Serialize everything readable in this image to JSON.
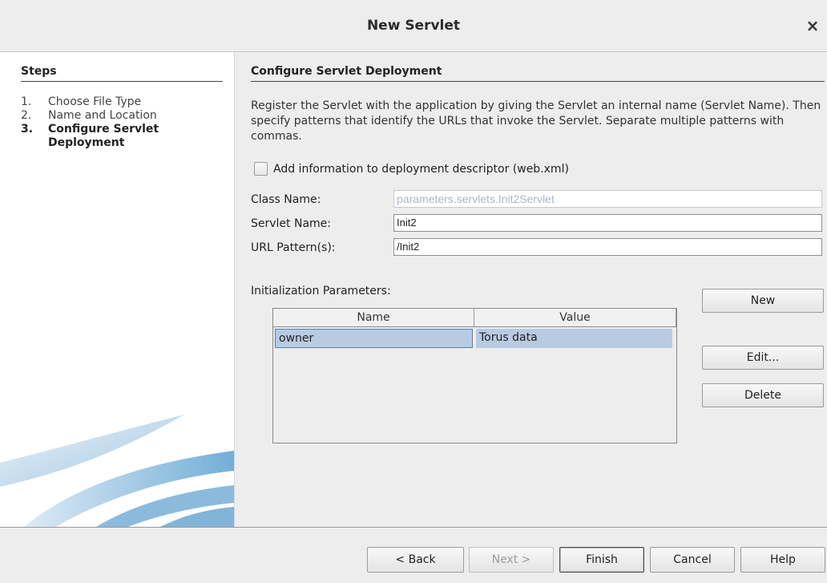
{
  "window": {
    "title": "New Servlet",
    "close_glyph": "×"
  },
  "steps": {
    "heading": "Steps",
    "items": [
      {
        "num": "1.",
        "label": "Choose File Type"
      },
      {
        "num": "2.",
        "label": "Name and Location"
      },
      {
        "num": "3.",
        "label": "Configure Servlet Deployment"
      }
    ],
    "active_index": 2
  },
  "main": {
    "heading": "Configure Servlet Deployment",
    "description": "Register the Servlet with the application by giving the Servlet an internal name (Servlet Name). Then specify patterns that identify the URLs that invoke the Servlet. Separate multiple patterns with commas.",
    "checkbox": {
      "label": "Add information to deployment descriptor (web.xml)",
      "checked": false
    },
    "fields": {
      "class_name": {
        "label": "Class Name:",
        "value": "parameters.servlets.Init2Servlet"
      },
      "servlet_name": {
        "label": "Servlet Name:",
        "value": "Init2"
      },
      "url_patterns": {
        "label": "URL Pattern(s):",
        "value": "/Init2"
      }
    },
    "init_params": {
      "label": "Initialization Parameters:",
      "columns": [
        "Name",
        "Value"
      ],
      "rows": [
        {
          "name": "owner",
          "value": "Torus data"
        }
      ]
    },
    "buttons": {
      "new": "New",
      "edit": "Edit...",
      "delete": "Delete"
    }
  },
  "footer": {
    "back": "< Back",
    "next": "Next >",
    "finish": "Finish",
    "cancel": "Cancel",
    "help": "Help"
  },
  "colors": {
    "selection": "#b8cbe2",
    "disabled_text": "#a9b7c9",
    "deco_blue": "#5aa0d0"
  }
}
